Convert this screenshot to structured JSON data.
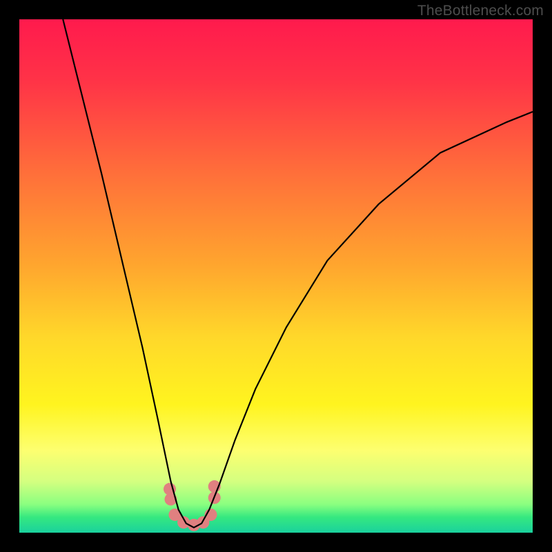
{
  "watermark": "TheBottleneck.com",
  "chart_data": {
    "type": "line",
    "title": "",
    "xlabel": "",
    "ylabel": "",
    "xlim": [
      0,
      1
    ],
    "ylim": [
      0,
      1
    ],
    "note": "Axes are unlabeled in the source image; values are normalized 0–1. The black curve is a V-shaped dip reaching near zero around x≈0.33. Pink dots cluster near the trough.",
    "series": [
      {
        "name": "curve",
        "color": "#000000",
        "x": [
          0.085,
          0.12,
          0.16,
          0.2,
          0.24,
          0.27,
          0.295,
          0.31,
          0.325,
          0.34,
          0.355,
          0.37,
          0.39,
          0.42,
          0.46,
          0.52,
          0.6,
          0.7,
          0.82,
          0.95,
          1.0
        ],
        "y": [
          1.0,
          0.86,
          0.7,
          0.53,
          0.36,
          0.22,
          0.1,
          0.045,
          0.018,
          0.01,
          0.018,
          0.045,
          0.095,
          0.18,
          0.28,
          0.4,
          0.53,
          0.64,
          0.74,
          0.8,
          0.82
        ]
      }
    ],
    "dots": {
      "name": "trough-markers",
      "color": "#e08080",
      "points": [
        {
          "x": 0.293,
          "y": 0.085
        },
        {
          "x": 0.295,
          "y": 0.065
        },
        {
          "x": 0.303,
          "y": 0.035
        },
        {
          "x": 0.32,
          "y": 0.02
        },
        {
          "x": 0.34,
          "y": 0.015
        },
        {
          "x": 0.358,
          "y": 0.02
        },
        {
          "x": 0.373,
          "y": 0.035
        },
        {
          "x": 0.38,
          "y": 0.068
        },
        {
          "x": 0.38,
          "y": 0.09
        }
      ]
    },
    "background_gradient": {
      "stops": [
        {
          "offset": 0.0,
          "color": "#ff1a4d"
        },
        {
          "offset": 0.12,
          "color": "#ff3347"
        },
        {
          "offset": 0.3,
          "color": "#ff6f3a"
        },
        {
          "offset": 0.48,
          "color": "#ffa62e"
        },
        {
          "offset": 0.62,
          "color": "#ffd82a"
        },
        {
          "offset": 0.75,
          "color": "#fff41f"
        },
        {
          "offset": 0.84,
          "color": "#fdff70"
        },
        {
          "offset": 0.9,
          "color": "#d4ff80"
        },
        {
          "offset": 0.945,
          "color": "#8aff80"
        },
        {
          "offset": 0.97,
          "color": "#35e880"
        },
        {
          "offset": 1.0,
          "color": "#1ad19d"
        }
      ]
    }
  }
}
